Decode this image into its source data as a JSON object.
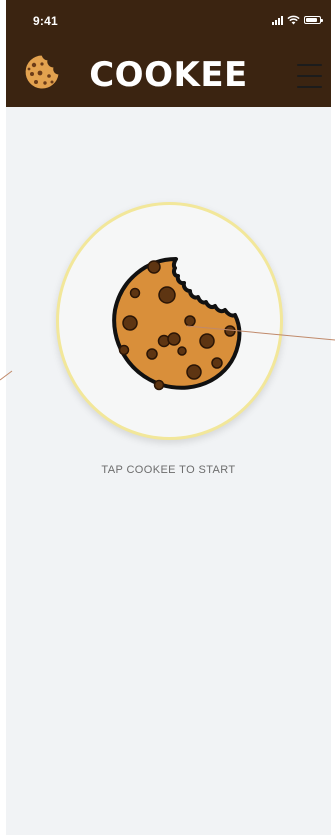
{
  "status_bar": {
    "time": "9:41"
  },
  "header": {
    "title": "COOKEE",
    "logo_icon": "cookie-logo-icon",
    "menu_icon": "hamburger-menu-icon"
  },
  "main": {
    "cookie_icon": "bitten-cookie-icon",
    "prompt": "TAP COOKEE TO START"
  },
  "colors": {
    "header_bg": "#3b2411",
    "screen_bg": "#f1f3f5",
    "circle_border": "#f2e79a",
    "cookie": "#d98f3a"
  }
}
